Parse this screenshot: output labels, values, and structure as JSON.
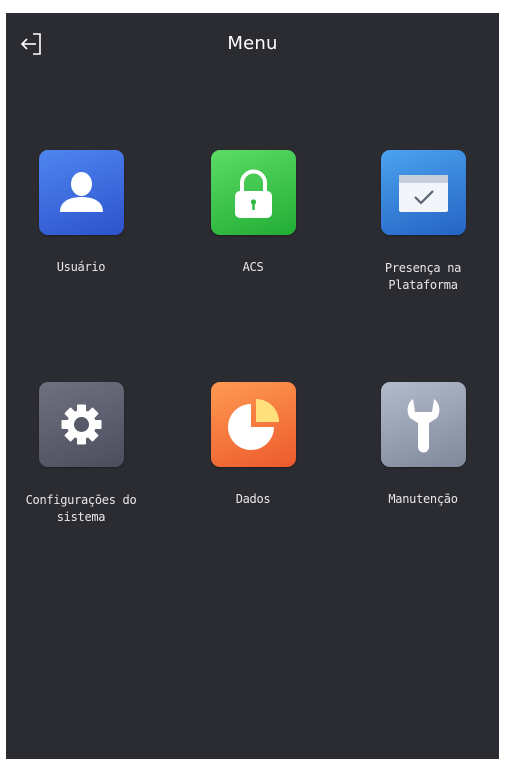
{
  "header": {
    "title": "Menu",
    "back_icon": "logout-arrow-icon"
  },
  "menu": [
    {
      "label": "Usuário",
      "icon": "user-icon",
      "color": "#3b6ee0"
    },
    {
      "label": "ACS",
      "icon": "padlock-icon",
      "color": "#36c247"
    },
    {
      "label_line1": "Presença na",
      "label_line2": "Plataforma",
      "icon": "calendar-check-icon",
      "color": "#3a86e0"
    },
    {
      "label_line1": "Configurações do",
      "label_line2": "sistema",
      "icon": "gear-icon",
      "color": "#5a5d6b"
    },
    {
      "label": "Dados",
      "icon": "pie-chart-icon",
      "color": "#f4783c"
    },
    {
      "label": "Manutenção",
      "icon": "wrench-icon",
      "color": "#98a1b3"
    }
  ]
}
